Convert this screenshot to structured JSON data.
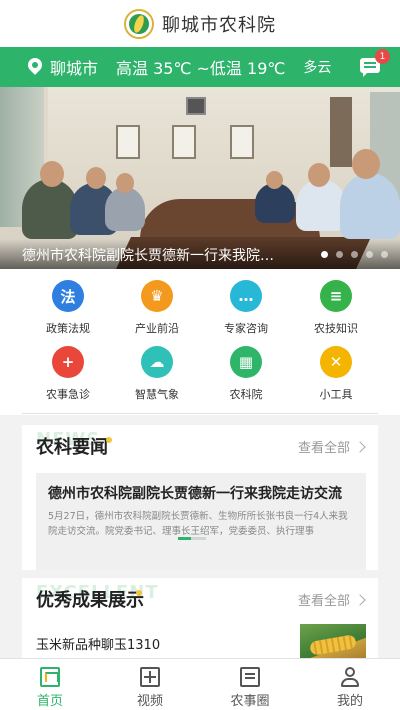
{
  "app": {
    "title": "聊城市农科院"
  },
  "weather": {
    "city": "聊城市",
    "temperature": "高温 35℃ ~低温 19℃",
    "condition": "多云",
    "message_count": "1"
  },
  "banner": {
    "caption": "德州市农科院副院长贾德新一行来我院…",
    "slide_count": 5,
    "active_slide": 1
  },
  "features": [
    {
      "label": "政策法规",
      "icon": "policy-icon",
      "color": "#2f7fe0",
      "glyph": "法"
    },
    {
      "label": "产业前沿",
      "icon": "trophy-icon",
      "color": "#f39a1e",
      "glyph": "♛"
    },
    {
      "label": "专家咨询",
      "icon": "chat-icon",
      "color": "#27b8d8",
      "glyph": "…"
    },
    {
      "label": "农技知识",
      "icon": "book-icon",
      "color": "#35b34a",
      "glyph": "≡"
    },
    {
      "label": "农事急诊",
      "icon": "first-aid-icon",
      "color": "#e8473a",
      "glyph": "+"
    },
    {
      "label": "智慧气象",
      "icon": "cloud-icon",
      "color": "#2fc0b8",
      "glyph": "☁"
    },
    {
      "label": "农科院",
      "icon": "building-icon",
      "color": "#2fb56a",
      "glyph": "▦"
    },
    {
      "label": "小工具",
      "icon": "tools-icon",
      "color": "#f5b400",
      "glyph": "✕"
    }
  ],
  "news": {
    "watermark": "NEWS",
    "title": "农科要闻",
    "see_all": "查看全部",
    "headline": "德州市农科院副院长贾德新一行来我院走访交流",
    "summary": "5月27日，德州市农科院副院长贾德新、生物所所长张书良一行4人来我院走访交流。院党委书记、理事长王绍军，党委委员、执行理事",
    "accent": "#2eb36b"
  },
  "results": {
    "watermark": "EXCELLENT",
    "title": "优秀成果展示",
    "see_all": "查看全部",
    "item_name": "玉米新品种聊玉1310"
  },
  "tabs": [
    {
      "label": "首页",
      "icon": "home-icon",
      "active": true
    },
    {
      "label": "视频",
      "icon": "video-icon",
      "active": false
    },
    {
      "label": "农事圈",
      "icon": "post-icon",
      "active": false
    },
    {
      "label": "我的",
      "icon": "profile-icon",
      "active": false
    }
  ]
}
